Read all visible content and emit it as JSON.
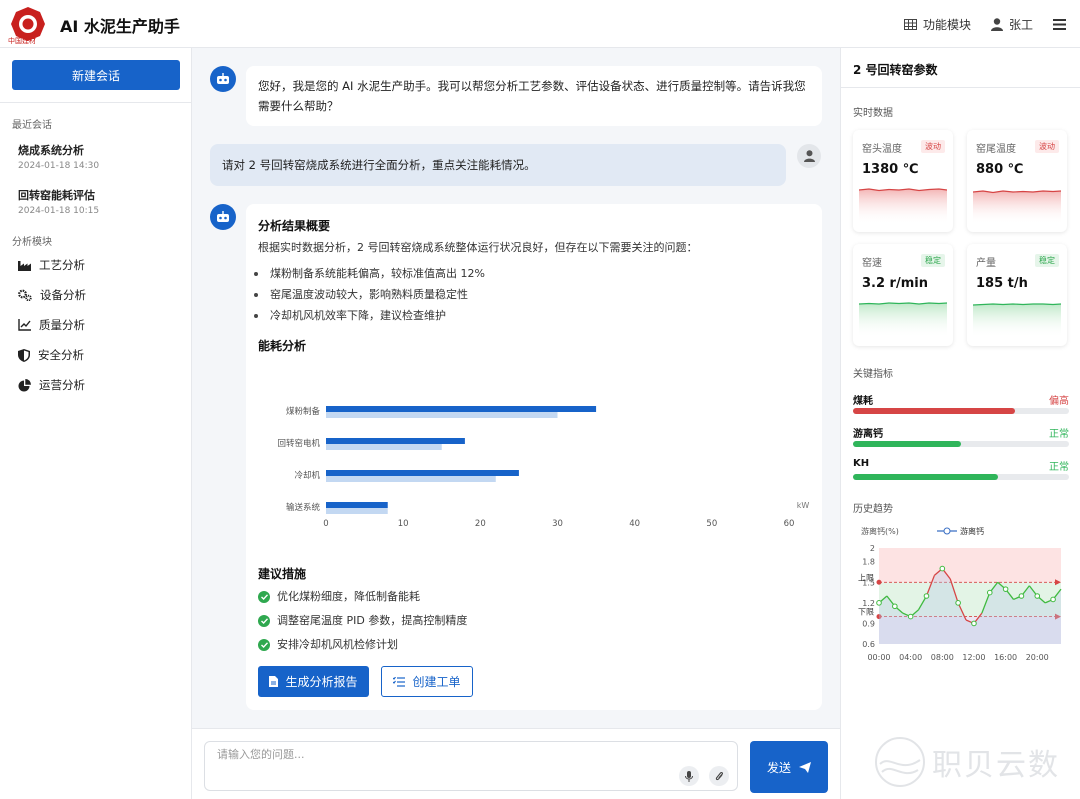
{
  "header": {
    "title": "AI 水泥生产助手",
    "logo_text": "中国建材",
    "func_label": "功能模块",
    "user_label": "张工"
  },
  "sidebar": {
    "new_chat": "新建会话",
    "recent_label": "最近会话",
    "recent": [
      {
        "title": "烧成系统分析",
        "time": "2024-01-18 14:30"
      },
      {
        "title": "回转窑能耗评估",
        "time": "2024-01-18 10:15"
      }
    ],
    "modules_label": "分析模块",
    "modules": [
      {
        "label": "工艺分析",
        "icon": "factory-icon"
      },
      {
        "label": "设备分析",
        "icon": "gears-icon"
      },
      {
        "label": "质量分析",
        "icon": "line-chart-icon"
      },
      {
        "label": "安全分析",
        "icon": "shield-icon"
      },
      {
        "label": "运营分析",
        "icon": "pie-chart-icon"
      }
    ]
  },
  "chat": {
    "greeting": "您好，我是您的 AI 水泥生产助手。我可以帮您分析工艺参数、评估设备状态、进行质量控制等。请告诉我您需要什么帮助？",
    "user_msg": "请对 2 号回转窑烧成系统进行全面分析，重点关注能耗情况。",
    "result": {
      "heading": "分析结果概要",
      "intro": "根据实时数据分析，2 号回转窑烧成系统整体运行状况良好，但存在以下需要关注的问题：",
      "bullets": [
        "煤粉制备系统能耗偏高，较标准值高出 12%",
        "窑尾温度波动较大，影响熟料质量稳定性",
        "冷却机风机效率下降，建议检查维护"
      ],
      "energy_heading": "能耗分析",
      "suggest_heading": "建议措施",
      "suggestions": [
        "优化煤粉细度，降低制备能耗",
        "调整窑尾温度 PID 参数，提高控制精度",
        "安排冷却机风机检修计划"
      ],
      "btn_report": "生成分析报告",
      "btn_order": "创建工单"
    }
  },
  "chart_data": [
    {
      "type": "bar",
      "orientation": "horizontal",
      "categories": [
        "煤粉制备",
        "回转窑电机",
        "冷却机",
        "输送系统"
      ],
      "series": [
        {
          "values": [
            35,
            18,
            25,
            8
          ],
          "color": "#1763c9"
        },
        {
          "values": [
            30,
            15,
            22,
            8
          ],
          "color": "#c3d8f2"
        }
      ],
      "unit_label": "kW",
      "xlim": [
        0,
        60
      ],
      "xticks": [
        0,
        10,
        20,
        30,
        40,
        50,
        60
      ]
    },
    {
      "type": "line",
      "ylabel": "游离钙(%)",
      "legend": "游离钙",
      "x": [
        "00:00",
        "01:00",
        "02:00",
        "03:00",
        "04:00",
        "05:00",
        "06:00",
        "07:00",
        "08:00",
        "09:00",
        "10:00",
        "11:00",
        "12:00",
        "13:00",
        "14:00",
        "15:00",
        "16:00",
        "17:00",
        "18:00",
        "19:00",
        "20:00",
        "21:00",
        "22:00",
        "23:00"
      ],
      "values": [
        1.2,
        1.3,
        1.15,
        1.05,
        1.0,
        1.1,
        1.3,
        1.6,
        1.7,
        1.55,
        1.2,
        0.95,
        0.9,
        1.05,
        1.35,
        1.5,
        1.4,
        1.25,
        1.3,
        1.45,
        1.3,
        1.2,
        1.25,
        1.4
      ],
      "upper_limit": 1.5,
      "lower_limit": 1.0,
      "upper_label": "上限",
      "lower_label": "下限",
      "yticks": [
        0.6,
        0.9,
        1.2,
        1.5,
        1.8,
        2
      ],
      "ylim": [
        0.6,
        2.0
      ],
      "xtick_labels": [
        "00:00",
        "04:00",
        "08:00",
        "12:00",
        "16:00",
        "20:00"
      ]
    }
  ],
  "right": {
    "title": "2 号回转窑参数",
    "realtime_label": "实时数据",
    "cards": [
      {
        "name": "窑头温度",
        "badge": "波动",
        "value": "1380 ℃",
        "status": "red"
      },
      {
        "name": "窑尾温度",
        "badge": "波动",
        "value": "880 ℃",
        "status": "red"
      },
      {
        "name": "窑速",
        "badge": "稳定",
        "value": "3.2 r/min",
        "status": "green"
      },
      {
        "name": "产量",
        "badge": "稳定",
        "value": "185 t/h",
        "status": "green"
      }
    ],
    "key_label": "关键指标",
    "indicators": [
      {
        "name": "煤耗",
        "status": "偏高",
        "level": 0.75,
        "color": "#d64545"
      },
      {
        "name": "游离钙",
        "status": "正常",
        "level": 0.5,
        "color": "#2fb55a"
      },
      {
        "name": "KH",
        "status": "正常",
        "level": 0.67,
        "color": "#2fb55a"
      }
    ],
    "history_label": "历史趋势"
  },
  "input": {
    "placeholder": "请输入您的问题...",
    "send": "发送"
  },
  "watermark": "职贝云数"
}
